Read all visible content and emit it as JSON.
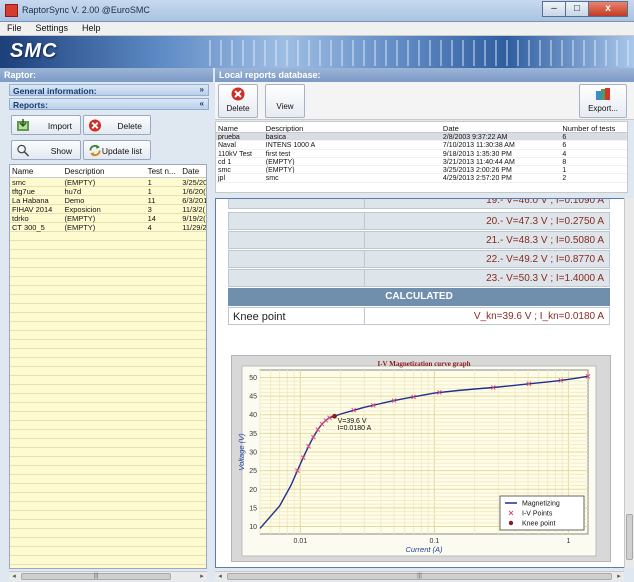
{
  "window": {
    "title": "RaptorSync V. 2.00 @EuroSMC",
    "minimize": "–",
    "maximize": "□",
    "close": "x"
  },
  "menu": [
    "File",
    "Settings",
    "Help"
  ],
  "banner": {
    "logo": "SMC"
  },
  "left": {
    "header": "Raptor:",
    "general_info": "General information:",
    "reports": "Reports:",
    "buttons": {
      "import": "Import",
      "delete": "Delete",
      "show": "Show",
      "update": "Update list"
    },
    "columns": [
      "Name",
      "Description",
      "Test n...",
      "Date"
    ],
    "rows": [
      [
        "smc",
        "(EMPTY)",
        "1",
        "3/25/20"
      ],
      [
        "tftg7ue",
        "hu7d",
        "1",
        "1/6/20("
      ],
      [
        "La Habana",
        "Demo",
        "11",
        "6/3/201"
      ],
      [
        "FIHAV 2014",
        "Exposicion",
        "3",
        "11/3/2("
      ],
      [
        "tdrko",
        "(EMPTY)",
        "14",
        "9/19/2("
      ],
      [
        "CT 300_5",
        "(EMPTY)",
        "4",
        "11/29/2"
      ]
    ]
  },
  "right": {
    "header": "Local reports database:",
    "buttons": {
      "delete": "Delete",
      "view": "View",
      "export": "Export..."
    },
    "columns": [
      "Name",
      "Description",
      "Date",
      "Number of tests"
    ],
    "rows": [
      [
        "prueba",
        "basica",
        "2/8/2003 9:37:22 AM",
        "6"
      ],
      [
        "Naval",
        "INTENS 1000 A",
        "7/10/2013 11:30:38 AM",
        "6"
      ],
      [
        "110kV Test",
        "first test",
        "9/18/2013 1:35:30 PM",
        "4"
      ],
      [
        "cd 1",
        "(EMPTY)",
        "3/21/2013 11:40:44 AM",
        "8"
      ],
      [
        "smc",
        "(EMPTY)",
        "3/25/2013 2:00:26 PM",
        "1"
      ],
      [
        "jpl",
        "smc",
        "4/29/2013 2:57:20 PM",
        "2"
      ]
    ],
    "selected_row": 0
  },
  "report": {
    "partial_row": "19.- V=46.0 V ; I=0.1090 A",
    "points": [
      "20.- V=47.3 V ; I=0.2750 A",
      "21.- V=48.3 V ; I=0.5080 A",
      "22.- V=49.2 V ; I=0.8770 A",
      "23.- V=50.3 V ; I=1.4000 A"
    ],
    "calculated": "CALCULATED",
    "knee_label": "Knee point",
    "knee_value": "V_kn=39.6 V ; I_kn=0.0180 A"
  },
  "chart_data": {
    "type": "line",
    "title": "I-V Magnetization curve graph",
    "xlabel": "Current (A)",
    "ylabel": "Voltage (V)",
    "x_scale": "log",
    "xlim": [
      0.005,
      1.4
    ],
    "ylim": [
      8,
      52
    ],
    "x_ticks": [
      0.01,
      0.1,
      1
    ],
    "x_tick_labels": [
      "0.01",
      "0.1",
      "1"
    ],
    "y_ticks": [
      10,
      15,
      20,
      25,
      30,
      35,
      40,
      45,
      50
    ],
    "grid": true,
    "legend_position": "bottom-right",
    "series": [
      {
        "name": "Magnetizing",
        "color": "#1e2f8f",
        "x": [
          0.005,
          0.007,
          0.0085,
          0.0095,
          0.0105,
          0.0115,
          0.0125,
          0.0135,
          0.0145,
          0.0155,
          0.0165,
          0.018,
          0.02,
          0.025,
          0.03,
          0.04,
          0.05,
          0.07,
          0.1,
          0.15,
          0.2,
          0.275,
          0.4,
          0.508,
          0.7,
          0.877,
          1.1,
          1.4
        ],
        "y": [
          9.5,
          15.5,
          21,
          25,
          28.5,
          31.5,
          34,
          36,
          37.5,
          38.5,
          39.2,
          39.6,
          40.2,
          41.2,
          42,
          43,
          43.8,
          44.8,
          45.8,
          46.5,
          46.9,
          47.3,
          47.9,
          48.3,
          48.8,
          49.2,
          49.7,
          50.3
        ]
      },
      {
        "name": "I-V Points",
        "color": "#d94b7b",
        "x": [
          0.0095,
          0.0105,
          0.0115,
          0.0125,
          0.0135,
          0.0145,
          0.0155,
          0.0165,
          0.025,
          0.035,
          0.05,
          0.07,
          0.109,
          0.275,
          0.508,
          0.877,
          1.4
        ],
        "y": [
          25,
          28.5,
          31.5,
          34,
          36,
          37.5,
          38.5,
          39.2,
          41.2,
          42.5,
          43.8,
          44.8,
          46.0,
          47.3,
          48.3,
          49.2,
          50.3
        ]
      },
      {
        "name": "Knee point",
        "color": "#8b1a1a",
        "x": [
          0.018
        ],
        "y": [
          39.6
        ]
      }
    ],
    "annotation": [
      "V=39.6 V",
      "I=0.0180 A"
    ]
  }
}
